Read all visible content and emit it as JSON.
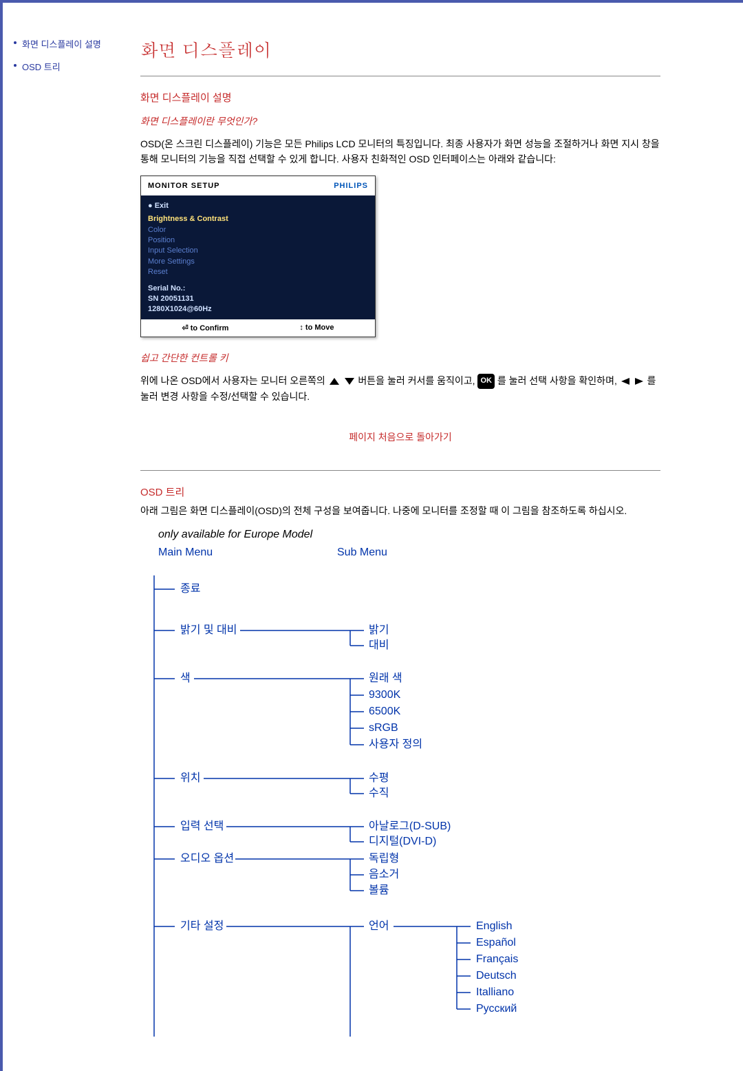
{
  "sidebar": {
    "items": [
      {
        "label": "화면 디스플레이 설명"
      },
      {
        "label": "OSD 트리"
      }
    ]
  },
  "title": "화면 디스플레이",
  "section1": {
    "heading": "화면 디스플레이 설명",
    "subheading": "화면 디스플레이란 무엇인가?",
    "para": "OSD(온 스크린 디스플레이) 기능은 모든 Philips LCD 모니터의 특징입니다. 최종 사용자가 화면 성능을 조절하거나 화면 지시 창을 통해 모니터의 기능을 직접 선택할 수 있게 합니다. 사용자 친화적인 OSD 인터페이스는 아래와 같습니다:"
  },
  "osd": {
    "header": "MONITOR SETUP",
    "brand": "PHILIPS",
    "exit": "● Exit",
    "hl": "    Brightness & Contrast",
    "items": [
      "    Color",
      "    Position",
      "    Input Selection",
      "    More Settings",
      "    Reset"
    ],
    "serial1": "Serial No.:",
    "serial2": "  SN 20051131",
    "serial3": "1280X1024@60Hz",
    "foot1": "⏎ to Confirm",
    "foot2": "↕ to Move"
  },
  "section2": {
    "subheading": "쉽고 간단한 컨트롤 키",
    "para1a": "위에 나온 OSD에서 사용자는 모니터 오른쪽의 ",
    "para1b": " 버튼을 눌러 커서를 움직이고, ",
    "ok": "OK",
    "para1c": " 를 눌러 선택 사항을 확인하며, ",
    "para1d": " 를 눌러 변경 사항을 수정/선택할 수 있습니다."
  },
  "back_top": "페이지 처음으로 돌아가기",
  "section3": {
    "heading": "OSD 트리",
    "para": "아래 그림은 화면 디스플레이(OSD)의 전체 구성을 보여줍니다. 나중에 모니터를 조정할 때 이 그림을 참조하도록 하십시오.",
    "only_europe": "only available for Europe Model",
    "main_menu_label": "Main Menu",
    "sub_menu_label": "Sub Menu"
  },
  "tree": {
    "items": [
      {
        "label": "종료",
        "sub": []
      },
      {
        "label": "밝기 및 대비",
        "sub": [
          "밝기",
          "대비"
        ]
      },
      {
        "label": "색",
        "sub": [
          "원래 색",
          "9300K",
          "6500K",
          "sRGB",
          "사용자 정의"
        ]
      },
      {
        "label": "위치",
        "sub": [
          "수평",
          "수직"
        ]
      },
      {
        "label": "입력 선택",
        "sub": [
          "아날로그(D-SUB)",
          "디지털(DVI-D)"
        ]
      },
      {
        "label": "오디오 옵션",
        "sub": [
          "독립형",
          "음소거",
          "볼륨"
        ]
      },
      {
        "label": "기타 설정",
        "sub_label": "언어",
        "sub3": [
          "English",
          "Español",
          "Français",
          "Deutsch",
          "Italliano",
          "Русский"
        ]
      }
    ]
  }
}
